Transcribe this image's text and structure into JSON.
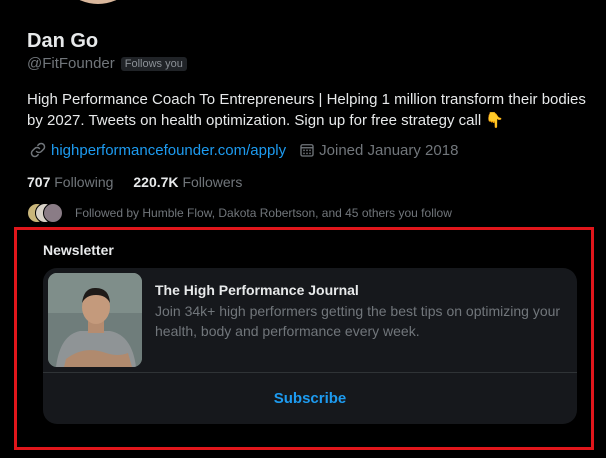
{
  "profile": {
    "name": "Dan Go",
    "handle": "@FitFounder",
    "follows_badge": "Follows you",
    "bio": "High Performance Coach To Entrepreneurs | Helping 1 million transform their bodies by 2027. Tweets on health optimization. Sign up for free strategy call 👇",
    "link_icon": "link-icon",
    "link": "highperformancefounder.com/apply",
    "calendar_icon": "calendar-icon",
    "joined": "Joined January 2018",
    "following_count": "707",
    "following_label": "Following",
    "followers_count": "220.7K",
    "followers_label": "Followers",
    "followed_by": "Followed by Humble Flow, Dakota Robertson, and 45 others you follow"
  },
  "newsletter": {
    "section_title": "Newsletter",
    "title": "The High Performance Journal",
    "description": "Join 34k+ high performers getting the best tips on optimizing your health, body and performance every week.",
    "subscribe_label": "Subscribe"
  },
  "colors": {
    "background": "#000000",
    "text_primary": "#e7e9ea",
    "text_secondary": "#71767b",
    "accent": "#1d9bf0",
    "card": "#16181c",
    "highlight": "#e0161b"
  }
}
